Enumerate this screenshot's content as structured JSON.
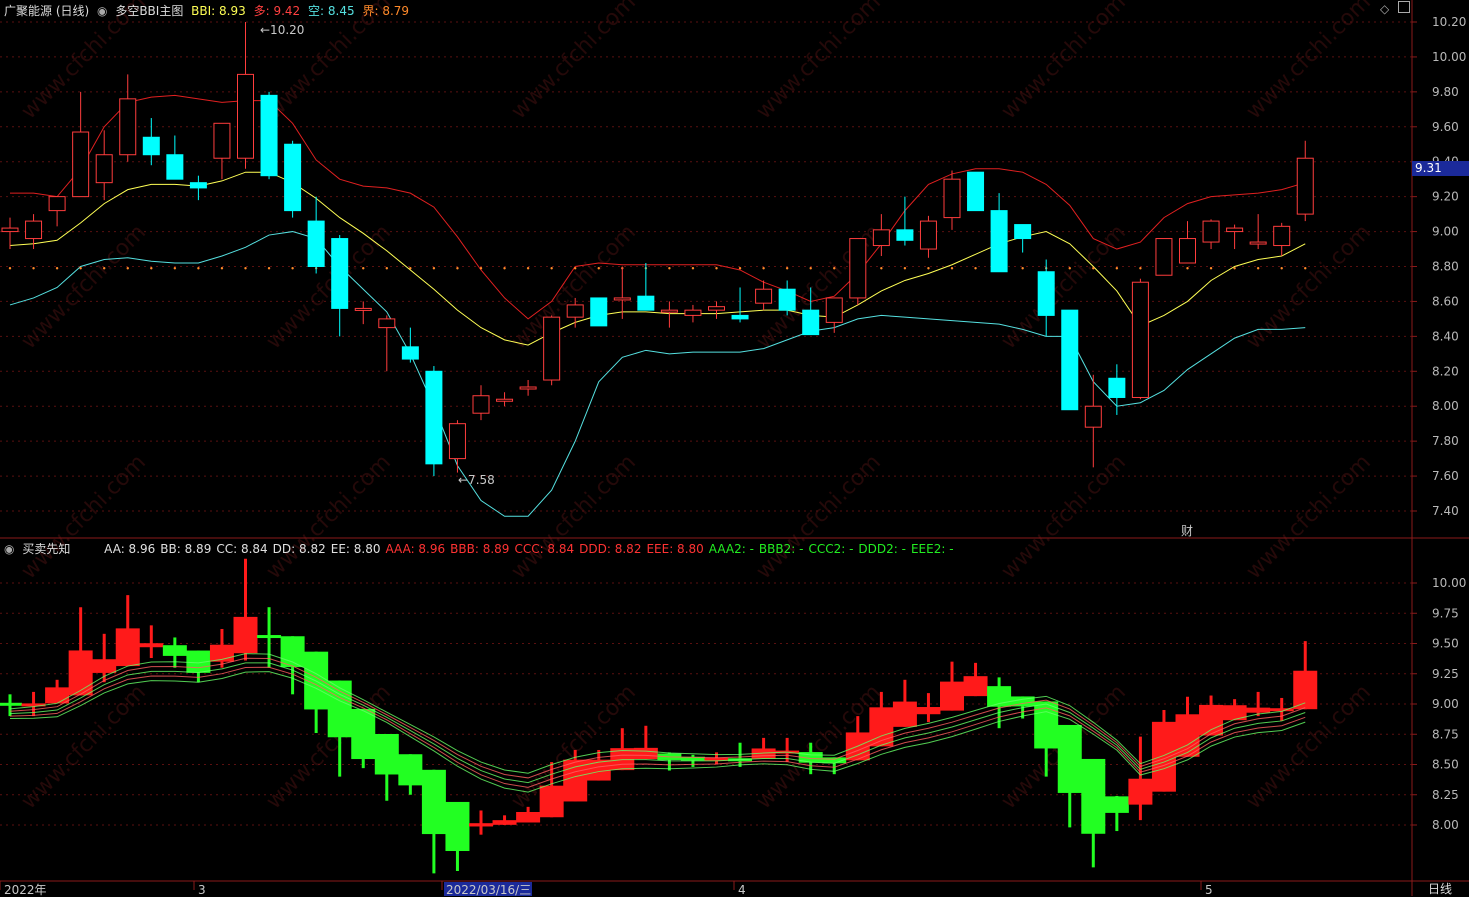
{
  "header_top": {
    "title": "广聚能源 (日线)",
    "indicator": "多空BBI主图",
    "bbi_label": "BBI:",
    "bbi": "8.93",
    "duo_label": "多:",
    "duo": "9.42",
    "kong_label": "空:",
    "kong": "8.45",
    "jie_label": "界:",
    "jie": "8.79"
  },
  "header_bottom": {
    "indicator": "买卖先知",
    "items": [
      {
        "t": "AA: 8.96",
        "c": "#e0e0e0"
      },
      {
        "t": "BB: 8.89",
        "c": "#e0e0e0"
      },
      {
        "t": "CC: 8.84",
        "c": "#e0e0e0"
      },
      {
        "t": "DD: 8.82",
        "c": "#e0e0e0"
      },
      {
        "t": "EE: 8.80",
        "c": "#e0e0e0"
      },
      {
        "t": "AAA: 8.96",
        "c": "#ff3333"
      },
      {
        "t": "BBB: 8.89",
        "c": "#ff3333"
      },
      {
        "t": "CCC: 8.84",
        "c": "#ff3333"
      },
      {
        "t": "DDD: 8.82",
        "c": "#ff3333"
      },
      {
        "t": "EEE: 8.80",
        "c": "#ff3333"
      },
      {
        "t": "AAA2: -",
        "c": "#22ee22"
      },
      {
        "t": "BBB2: -",
        "c": "#22ee22"
      },
      {
        "t": "CCC2: -",
        "c": "#22ee22"
      },
      {
        "t": "DDD2: -",
        "c": "#22ee22"
      },
      {
        "t": "EEE2: -",
        "c": "#22ee22"
      }
    ]
  },
  "price_tag": "9.31",
  "annotations": {
    "high": "10.20",
    "low": "7.58",
    "cai": "财"
  },
  "watermark": "www.cfchi.com",
  "date_axis": {
    "labels": [
      "2022年",
      "3",
      "2022/03/16/三",
      "4",
      "5"
    ],
    "period": "日线"
  },
  "colors": {
    "up": "#ff3d3d",
    "down": "#00ffff",
    "bbi": "#ffff55",
    "duo": "#e02020",
    "kong": "#55e0e0",
    "jie": "#ff8a2a",
    "up2": "#ff1a1a",
    "down2": "#22ff22"
  },
  "chart_data": [
    {
      "type": "candlestick",
      "title": "多空BBI主图",
      "ylim": [
        7.3,
        10.3
      ],
      "yticks": [
        7.4,
        7.6,
        7.8,
        8.0,
        8.2,
        8.4,
        8.6,
        8.8,
        9.0,
        9.2,
        9.4,
        9.6,
        9.8,
        10.0,
        10.2
      ],
      "candles": [
        [
          9.0,
          9.08,
          8.9,
          9.02
        ],
        [
          8.96,
          9.1,
          8.9,
          9.06
        ],
        [
          9.12,
          9.2,
          9.03,
          9.2
        ],
        [
          9.2,
          9.8,
          9.2,
          9.57
        ],
        [
          9.28,
          9.58,
          9.18,
          9.44
        ],
        [
          9.44,
          9.9,
          9.4,
          9.76
        ],
        [
          9.54,
          9.65,
          9.38,
          9.44
        ],
        [
          9.44,
          9.55,
          9.3,
          9.3
        ],
        [
          9.28,
          9.32,
          9.18,
          9.25
        ],
        [
          9.42,
          9.62,
          9.3,
          9.62
        ],
        [
          9.42,
          10.2,
          9.36,
          9.9
        ],
        [
          9.78,
          9.8,
          9.3,
          9.32
        ],
        [
          9.5,
          9.52,
          9.08,
          9.12
        ],
        [
          9.06,
          9.2,
          8.76,
          8.8
        ],
        [
          8.96,
          8.98,
          8.4,
          8.56
        ],
        [
          8.55,
          8.6,
          8.47,
          8.56
        ],
        [
          8.45,
          8.52,
          8.2,
          8.5
        ],
        [
          8.34,
          8.45,
          8.25,
          8.27
        ],
        [
          8.2,
          8.23,
          7.6,
          7.67
        ],
        [
          7.7,
          7.92,
          7.62,
          7.9
        ],
        [
          7.96,
          8.12,
          7.92,
          8.06
        ],
        [
          8.04,
          8.08,
          8.0,
          8.04
        ],
        [
          8.11,
          8.15,
          8.06,
          8.11
        ],
        [
          8.15,
          8.52,
          8.12,
          8.51
        ],
        [
          8.51,
          8.62,
          8.45,
          8.58
        ],
        [
          8.62,
          8.62,
          8.46,
          8.46
        ],
        [
          8.62,
          8.8,
          8.5,
          8.62
        ],
        [
          8.63,
          8.82,
          8.55,
          8.55
        ],
        [
          8.55,
          8.6,
          8.45,
          8.55
        ],
        [
          8.52,
          8.58,
          8.48,
          8.55
        ],
        [
          8.55,
          8.6,
          8.5,
          8.57
        ],
        [
          8.52,
          8.68,
          8.48,
          8.5
        ],
        [
          8.59,
          8.72,
          8.55,
          8.67
        ],
        [
          8.67,
          8.72,
          8.52,
          8.55
        ],
        [
          8.55,
          8.68,
          8.42,
          8.41
        ],
        [
          8.48,
          8.52,
          8.42,
          8.62
        ],
        [
          8.62,
          8.9,
          8.58,
          8.96
        ],
        [
          8.92,
          9.1,
          8.86,
          9.01
        ],
        [
          9.01,
          9.2,
          8.92,
          8.95
        ],
        [
          8.9,
          9.09,
          8.85,
          9.06
        ],
        [
          9.08,
          9.35,
          9.01,
          9.3
        ],
        [
          9.34,
          9.34,
          9.12,
          9.12
        ],
        [
          9.12,
          9.22,
          8.8,
          8.77
        ],
        [
          9.04,
          9.04,
          8.88,
          8.96
        ],
        [
          8.77,
          8.84,
          8.4,
          8.52
        ],
        [
          8.55,
          8.55,
          7.98,
          7.98
        ],
        [
          7.88,
          8.18,
          7.65,
          8.0
        ],
        [
          8.16,
          8.24,
          7.95,
          8.05
        ],
        [
          8.05,
          8.73,
          8.04,
          8.71
        ],
        [
          8.75,
          8.95,
          8.75,
          8.96
        ],
        [
          8.82,
          9.06,
          8.82,
          8.96
        ],
        [
          8.94,
          9.07,
          8.9,
          9.06
        ],
        [
          9.0,
          9.04,
          8.9,
          9.02
        ],
        [
          8.94,
          9.1,
          8.9,
          8.94
        ],
        [
          8.92,
          9.05,
          8.86,
          9.03
        ],
        [
          9.1,
          9.52,
          9.06,
          9.42
        ]
      ],
      "bbi": [
        8.92,
        8.93,
        8.95,
        9.05,
        9.16,
        9.24,
        9.27,
        9.27,
        9.26,
        9.29,
        9.34,
        9.34,
        9.28,
        9.19,
        9.08,
        8.99,
        8.89,
        8.78,
        8.67,
        8.55,
        8.45,
        8.38,
        8.35,
        8.42,
        8.48,
        8.52,
        8.54,
        8.54,
        8.53,
        8.53,
        8.53,
        8.54,
        8.55,
        8.55,
        8.52,
        8.51,
        8.58,
        8.66,
        8.72,
        8.76,
        8.81,
        8.87,
        8.93,
        8.97,
        9.0,
        8.93,
        8.8,
        8.66,
        8.46,
        8.52,
        8.6,
        8.72,
        8.8,
        8.84,
        8.86,
        8.93
      ],
      "duo": [
        9.22,
        9.22,
        9.2,
        9.36,
        9.6,
        9.74,
        9.77,
        9.78,
        9.76,
        9.74,
        9.75,
        9.75,
        9.62,
        9.41,
        9.3,
        9.26,
        9.25,
        9.22,
        9.14,
        8.97,
        8.78,
        8.62,
        8.5,
        8.6,
        8.8,
        8.82,
        8.81,
        8.81,
        8.81,
        8.81,
        8.81,
        8.78,
        8.71,
        8.66,
        8.6,
        8.63,
        8.76,
        8.93,
        9.12,
        9.27,
        9.33,
        9.36,
        9.36,
        9.34,
        9.27,
        9.15,
        8.96,
        8.9,
        8.94,
        9.08,
        9.16,
        9.2,
        9.21,
        9.22,
        9.24,
        9.28
      ],
      "kong": [
        8.58,
        8.62,
        8.68,
        8.8,
        8.84,
        8.85,
        8.83,
        8.82,
        8.82,
        8.86,
        8.91,
        8.98,
        9.0,
        8.96,
        8.8,
        8.67,
        8.54,
        8.3,
        8.0,
        7.66,
        7.46,
        7.37,
        7.37,
        7.52,
        7.8,
        8.14,
        8.28,
        8.32,
        8.3,
        8.31,
        8.31,
        8.31,
        8.33,
        8.38,
        8.43,
        8.45,
        8.5,
        8.52,
        8.51,
        8.5,
        8.49,
        8.48,
        8.47,
        8.44,
        8.4,
        8.4,
        8.14,
        8.0,
        8.02,
        8.09,
        8.21,
        8.3,
        8.39,
        8.44,
        8.44,
        8.45
      ],
      "jie": 8.79
    },
    {
      "type": "candlestick",
      "title": "买卖先知",
      "ylim": [
        7.6,
        10.3
      ],
      "yticks": [
        8.0,
        8.25,
        8.5,
        8.75,
        9.0,
        9.25,
        9.5,
        9.75,
        10.0
      ]
    }
  ]
}
